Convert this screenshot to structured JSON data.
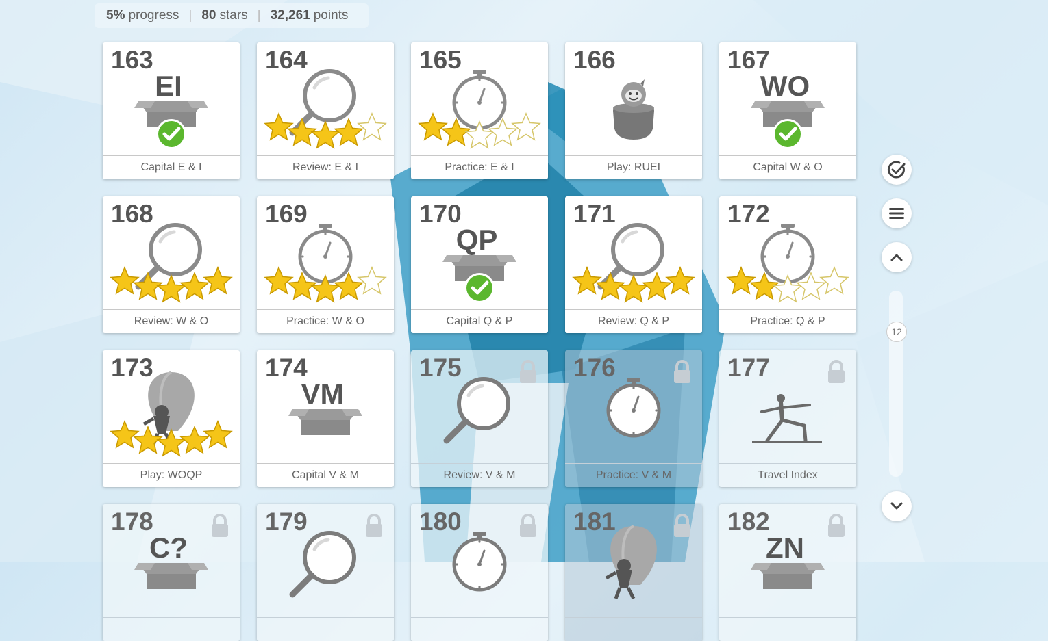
{
  "stats": {
    "progress_value": "5%",
    "progress_label": "progress",
    "stars_value": "80",
    "stars_label": "stars",
    "points_value": "32,261",
    "points_label": "points"
  },
  "levels": [
    {
      "num": "163",
      "label": "Capital E & I",
      "type": "box",
      "letters": "EI",
      "status": "completed",
      "stars": null
    },
    {
      "num": "164",
      "label": "Review: E & I",
      "type": "magnifier",
      "status": "open",
      "stars": 4
    },
    {
      "num": "165",
      "label": "Practice: E & I",
      "type": "stopwatch",
      "status": "open",
      "stars": 2
    },
    {
      "num": "166",
      "label": "Play: RUEI",
      "type": "ninja-jar",
      "status": "open",
      "stars": null
    },
    {
      "num": "167",
      "label": "Capital W & O",
      "type": "box",
      "letters": "WO",
      "status": "completed",
      "stars": null
    },
    {
      "num": "168",
      "label": "Review: W & O",
      "type": "magnifier",
      "status": "open",
      "stars": 5
    },
    {
      "num": "169",
      "label": "Practice: W & O",
      "type": "stopwatch",
      "status": "open",
      "stars": 4
    },
    {
      "num": "170",
      "label": "Capital Q & P",
      "type": "box",
      "letters": "QP",
      "status": "completed",
      "stars": null
    },
    {
      "num": "171",
      "label": "Review: Q & P",
      "type": "magnifier",
      "status": "open",
      "stars": 5
    },
    {
      "num": "172",
      "label": "Practice: Q & P",
      "type": "stopwatch",
      "status": "open",
      "stars": 2
    },
    {
      "num": "173",
      "label": "Play: WOQP",
      "type": "balloon",
      "status": "open",
      "stars": 5
    },
    {
      "num": "174",
      "label": "Capital V & M",
      "type": "box",
      "letters": "VM",
      "status": "open",
      "stars": null
    },
    {
      "num": "175",
      "label": "Review: V & M",
      "type": "magnifier",
      "status": "locked",
      "stars": null
    },
    {
      "num": "176",
      "label": "Practice: V & M",
      "type": "stopwatch",
      "status": "locked",
      "stars": null
    },
    {
      "num": "177",
      "label": "Travel Index",
      "type": "yoga",
      "status": "locked",
      "stars": null
    },
    {
      "num": "178",
      "label": "",
      "type": "box",
      "letters": "C?",
      "status": "locked",
      "stars": null
    },
    {
      "num": "179",
      "label": "",
      "type": "magnifier",
      "status": "locked",
      "stars": null
    },
    {
      "num": "180",
      "label": "",
      "type": "stopwatch",
      "status": "locked",
      "stars": null
    },
    {
      "num": "181",
      "label": "",
      "type": "balloon",
      "status": "locked",
      "stars": null
    },
    {
      "num": "182",
      "label": "",
      "type": "box",
      "letters": "ZN",
      "status": "locked",
      "stars": null
    }
  ],
  "sidebar": {
    "check_icon": "check-circle-icon",
    "menu_icon": "menu-icon",
    "up_icon": "chevron-up-icon",
    "down_icon": "chevron-down-icon",
    "scroll_indicator": "12"
  },
  "colors": {
    "star_gold": "#f5c518",
    "check_green": "#5bb72e",
    "icon_gray": "#8a8a8a"
  }
}
